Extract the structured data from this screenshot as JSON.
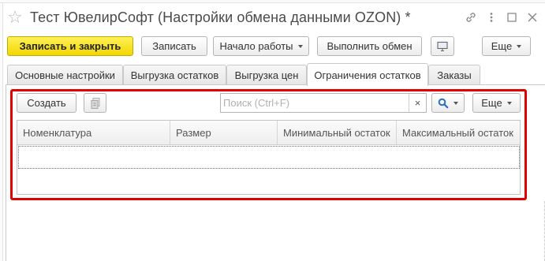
{
  "window": {
    "title": "Тест ЮвелирСофт (Настройки обмена данными OZON) *"
  },
  "toolbar": {
    "save_close": "Записать и закрыть",
    "save": "Записать",
    "start": "Начало работы",
    "run_exchange": "Выполнить обмен",
    "more": "Еще"
  },
  "tabs": [
    {
      "label": "Основные настройки",
      "active": false
    },
    {
      "label": "Выгрузка остатков",
      "active": false
    },
    {
      "label": "Выгрузка цен",
      "active": false
    },
    {
      "label": "Ограничения остатков",
      "active": true
    },
    {
      "label": "Заказы",
      "active": false
    }
  ],
  "panel": {
    "create": "Создать",
    "search_placeholder": "Поиск (Ctrl+F)",
    "clear": "×",
    "more": "Еще"
  },
  "table": {
    "columns": [
      "Номенклатура",
      "Размер",
      "Минимальный остаток",
      "Максимальный остаток"
    ],
    "rows": []
  },
  "colors": {
    "primary_button": "#f2d600",
    "highlight_border": "#e00000",
    "search_icon": "#2b6fbf"
  }
}
